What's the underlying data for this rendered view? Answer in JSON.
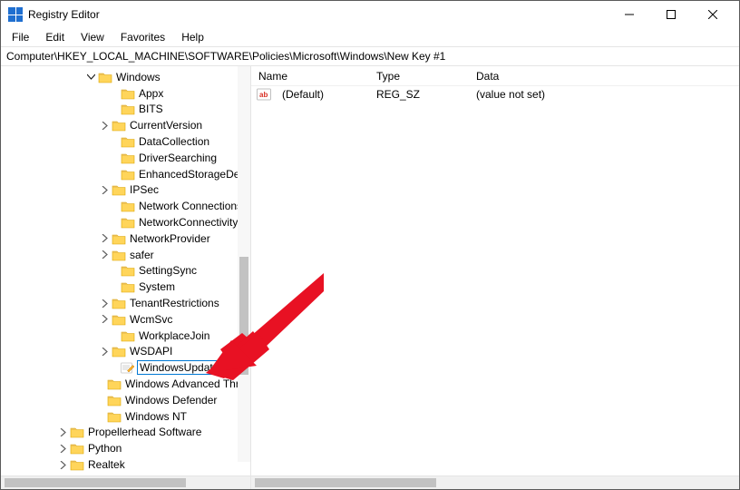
{
  "window": {
    "title": "Registry Editor"
  },
  "menubar": [
    "File",
    "Edit",
    "View",
    "Favorites",
    "Help"
  ],
  "addressbar": "Computer\\HKEY_LOCAL_MACHINE\\SOFTWARE\\Policies\\Microsoft\\Windows\\New Key #1",
  "tree": [
    {
      "indent": 93,
      "expander": "down",
      "label": "Windows"
    },
    {
      "indent": 118,
      "expander": "none",
      "label": "Appx"
    },
    {
      "indent": 118,
      "expander": "none",
      "label": "BITS"
    },
    {
      "indent": 108,
      "expander": "right",
      "label": "CurrentVersion"
    },
    {
      "indent": 118,
      "expander": "none",
      "label": "DataCollection"
    },
    {
      "indent": 118,
      "expander": "none",
      "label": "DriverSearching"
    },
    {
      "indent": 118,
      "expander": "none",
      "label": "EnhancedStorageDevices"
    },
    {
      "indent": 108,
      "expander": "right",
      "label": "IPSec"
    },
    {
      "indent": 118,
      "expander": "none",
      "label": "Network Connections"
    },
    {
      "indent": 118,
      "expander": "none",
      "label": "NetworkConnectivityStatus"
    },
    {
      "indent": 108,
      "expander": "right",
      "label": "NetworkProvider"
    },
    {
      "indent": 108,
      "expander": "right",
      "label": "safer"
    },
    {
      "indent": 118,
      "expander": "none",
      "label": "SettingSync"
    },
    {
      "indent": 118,
      "expander": "none",
      "label": "System"
    },
    {
      "indent": 108,
      "expander": "right",
      "label": "TenantRestrictions"
    },
    {
      "indent": 108,
      "expander": "right",
      "label": "WcmSvc"
    },
    {
      "indent": 118,
      "expander": "none",
      "label": "WorkplaceJoin"
    },
    {
      "indent": 108,
      "expander": "right",
      "label": "WSDAPI"
    },
    {
      "indent": 118,
      "expander": "none",
      "label": "WindowsUpdate",
      "editing": true,
      "icon": "compose"
    },
    {
      "indent": 103,
      "expander": "none",
      "label": "Windows Advanced Threat"
    },
    {
      "indent": 103,
      "expander": "none",
      "label": "Windows Defender"
    },
    {
      "indent": 103,
      "expander": "none",
      "label": "Windows NT"
    },
    {
      "indent": 62,
      "expander": "right",
      "label": "Propellerhead Software"
    },
    {
      "indent": 62,
      "expander": "right",
      "label": "Python"
    },
    {
      "indent": 62,
      "expander": "right",
      "label": "Realtek"
    }
  ],
  "list": {
    "columns": {
      "name": "Name",
      "type": "Type",
      "data": "Data"
    },
    "rows": [
      {
        "name": "(Default)",
        "type": "REG_SZ",
        "data": "(value not set)"
      }
    ]
  }
}
